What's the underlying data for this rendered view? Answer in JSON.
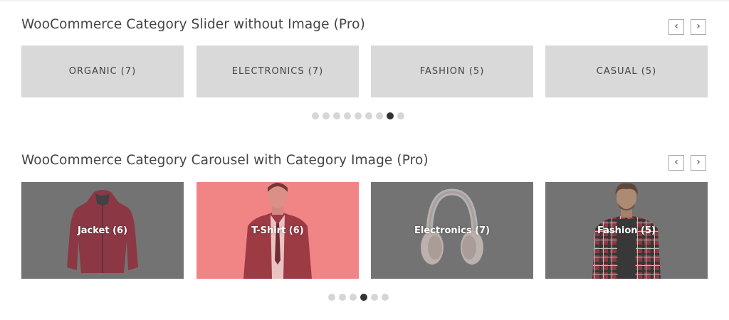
{
  "slider_section": {
    "title": "WooCommerce Category Slider without Image (Pro)",
    "prev_label": "‹",
    "next_label": "›",
    "categories": [
      {
        "name": "ORGANIC",
        "count": "(7)",
        "label": "ORGANIC (7)"
      },
      {
        "name": "ELECTRONICS",
        "count": "(7)",
        "label": "ELECTRONICS (7)"
      },
      {
        "name": "FASHION",
        "count": "(5)",
        "label": "FASHION (5)"
      },
      {
        "name": "CASUAL",
        "count": "(5)",
        "label": "CASUAL (5)"
      }
    ],
    "dots_total": 9,
    "dots_active_index": 7
  },
  "carousel_section": {
    "title": "WooCommerce Category Carousel with Category Image (Pro)",
    "prev_label": "‹",
    "next_label": "›",
    "categories": [
      {
        "label": "Jacket (6)",
        "image": "red-jacket"
      },
      {
        "label": "T-Shirt (6)",
        "image": "man-in-suit"
      },
      {
        "label": "Electronics (7)",
        "image": "headphones"
      },
      {
        "label": "Fashion (5)",
        "image": "man-in-plaid-shirt"
      }
    ],
    "dots_total": 6,
    "dots_active_index": 3
  },
  "colors": {
    "plain_tile": "#d9d9d9",
    "image_tile_overlay": "#777777",
    "highlight_tile": "#f28b8b",
    "active_dot": "#333333",
    "inactive_dot": "#d6d6d6"
  }
}
